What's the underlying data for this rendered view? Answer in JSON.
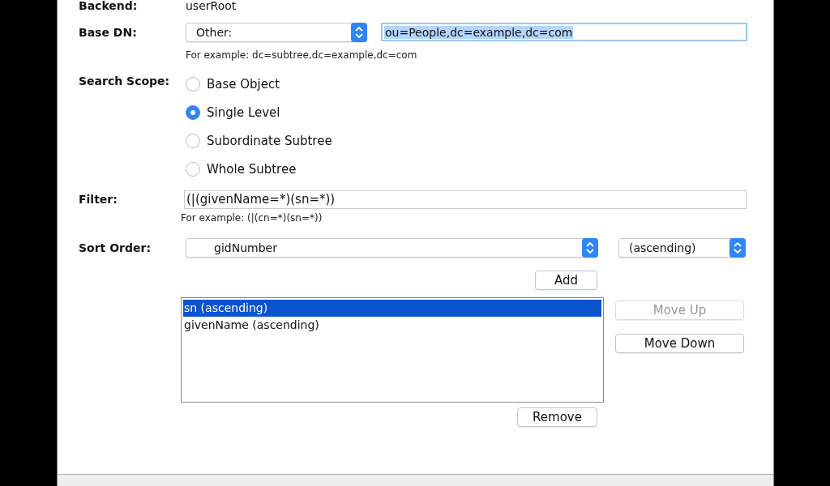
{
  "backend": {
    "label": "Backend:",
    "value": "userRoot"
  },
  "base_dn": {
    "label": "Base DN:",
    "dropdown": "Other:",
    "value": "ou=People,dc=example,dc=com",
    "text_selected": true,
    "hint": "For example: dc=subtree,dc=example,dc=com"
  },
  "search_scope": {
    "label": "Search Scope:",
    "options": [
      {
        "label": "Base Object",
        "selected": false
      },
      {
        "label": "Single Level",
        "selected": true
      },
      {
        "label": "Subordinate Subtree",
        "selected": false
      },
      {
        "label": "Whole Subtree",
        "selected": false
      }
    ]
  },
  "filter": {
    "label": "Filter:",
    "value": "(|(givenName=*)(sn=*))",
    "hint": "For example: (|(cn=*)(sn=*))"
  },
  "sort_order": {
    "label": "Sort Order:",
    "attribute": "gidNumber",
    "direction": "(ascending)",
    "add_button": "Add",
    "list": [
      {
        "label": "sn (ascending)",
        "selected": true
      },
      {
        "label": "givenName (ascending)",
        "selected": false
      }
    ],
    "buttons": [
      {
        "label": "Move Up",
        "disabled": true
      },
      {
        "label": "Move Down",
        "disabled": false
      }
    ],
    "remove_button": "Remove"
  }
}
